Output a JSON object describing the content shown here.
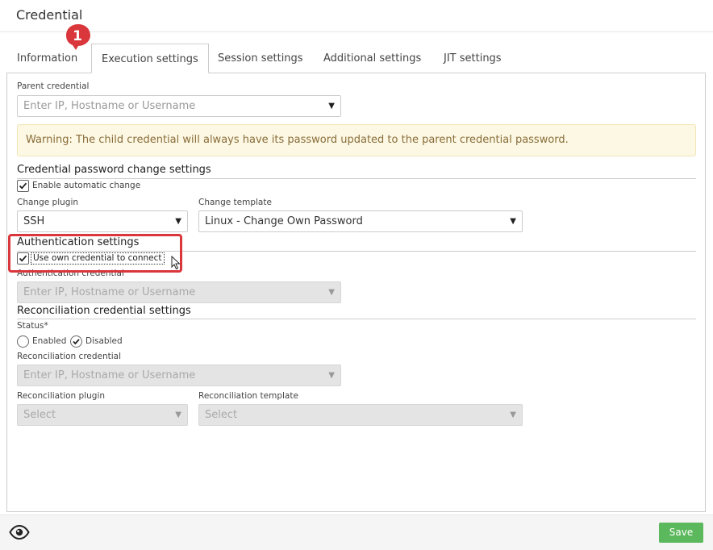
{
  "window": {
    "title": "Credential"
  },
  "tabs": [
    {
      "label": "Information"
    },
    {
      "label": "Execution settings"
    },
    {
      "label": "Session settings"
    },
    {
      "label": "Additional settings"
    },
    {
      "label": "JIT settings"
    }
  ],
  "annotation": {
    "step_number": "1",
    "color": "#d9373c"
  },
  "parent_credential": {
    "label": "Parent credential",
    "placeholder": "Enter IP, Hostname or Username"
  },
  "warning": {
    "text": "Warning: The child credential will always have its password updated to the parent credential password."
  },
  "password_change": {
    "title": "Credential password change settings",
    "enable_label": "Enable automatic change",
    "enable_checked": true,
    "plugin_label": "Change plugin",
    "plugin_value": "SSH",
    "template_label": "Change template",
    "template_value": "Linux - Change Own Password"
  },
  "authentication": {
    "title": "Authentication settings",
    "use_own_label": "Use own credential to connect",
    "use_own_checked": true,
    "credential_label": "Authentication credential",
    "credential_placeholder": "Enter IP, Hostname or Username"
  },
  "reconciliation": {
    "title": "Reconciliation credential settings",
    "status_label": "Status*",
    "status_options": [
      "Enabled",
      "Disabled"
    ],
    "status_selected": "Disabled",
    "credential_label": "Reconciliation credential",
    "credential_placeholder": "Enter IP, Hostname or Username",
    "plugin_label": "Reconciliation plugin",
    "plugin_placeholder": "Select",
    "template_label": "Reconciliation template",
    "template_placeholder": "Select"
  },
  "footer": {
    "save_label": "Save",
    "save_color": "#5cb85c",
    "visibility_icon": "eye-icon"
  }
}
